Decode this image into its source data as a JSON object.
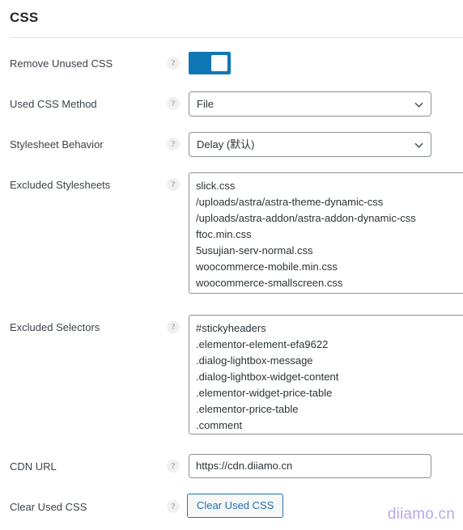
{
  "section": {
    "title": "CSS"
  },
  "help_glyph": "?",
  "colors": {
    "toggle_on": "#1077b5",
    "button_accent": "#2271b1",
    "heading": "#23282d",
    "label": "#3c434a",
    "border": "#8c8f94",
    "divider": "#e2e4e7",
    "watermark": "#b9a6e8"
  },
  "rows": [
    {
      "id": "remove-unused-css",
      "label": "Remove Unused CSS",
      "control": "toggle",
      "checked": true,
      "state_label": "On"
    },
    {
      "id": "used-css-method",
      "label": "Used CSS Method",
      "control": "select",
      "value": "File",
      "options": [
        "File"
      ]
    },
    {
      "id": "stylesheet-behavior",
      "label": "Stylesheet Behavior",
      "control": "select",
      "value": "Delay (默认)",
      "options": [
        "Delay (默认)"
      ]
    },
    {
      "id": "excluded-stylesheets",
      "label": "Excluded Stylesheets",
      "control": "textarea",
      "value": "slick.css\n/uploads/astra/astra-theme-dynamic-css\n/uploads/astra-addon/astra-addon-dynamic-css\nftoc.min.css\n5usujian-serv-normal.css\nwoocommerce-mobile.min.css\nwoocommerce-smallscreen.css"
    },
    {
      "id": "excluded-selectors",
      "label": "Excluded Selectors",
      "control": "textarea",
      "value": "#stickyheaders\n.elementor-element-efa9622\n.dialog-lightbox-message\n.dialog-lightbox-widget-content\n.elementor-widget-price-table\n.elementor-price-table\n.comment"
    },
    {
      "id": "cdn-url",
      "label": "CDN URL",
      "control": "text",
      "value": "https://cdn.diiamo.cn",
      "placeholder": ""
    },
    {
      "id": "clear-used-css",
      "label": "Clear Used CSS",
      "control": "button",
      "button_label": "Clear Used CSS"
    }
  ],
  "watermark": {
    "text": "diiamo.cn"
  }
}
